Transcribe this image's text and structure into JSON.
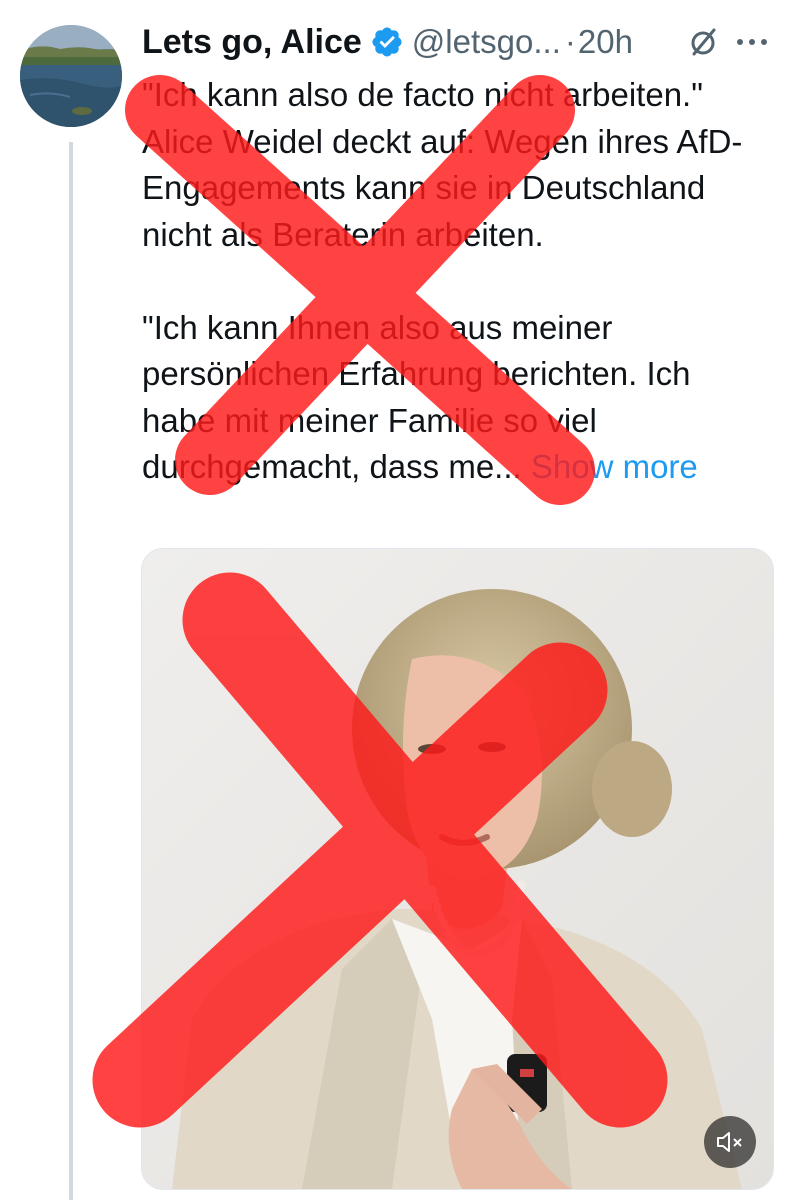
{
  "tweet": {
    "display_name": "Lets go, Alice",
    "handle": "@letsgo...",
    "separator": "·",
    "time": "20h",
    "paragraph1": "\"Ich kann also de facto nicht arbeiten.\" Alice Weidel deckt auf: Wegen ihres AfD-Engagements kann sie in Deutschland nicht als Beraterin arbeiten.",
    "paragraph2": "\"Ich kann Ihnen also aus meiner persönlichen Erfahrung berichten. Ich habe mit meiner Familie so viel durchgemacht, dass me...",
    "show_more": "Show more"
  },
  "icons": {
    "verified": "verified-badge-icon",
    "grok": "grok-icon",
    "more": "more-options-icon",
    "mute": "volume-muted-icon"
  },
  "colors": {
    "accent": "#1d9bf0",
    "secondary_text": "#536471",
    "overlay_x": "#ff1a1a"
  }
}
